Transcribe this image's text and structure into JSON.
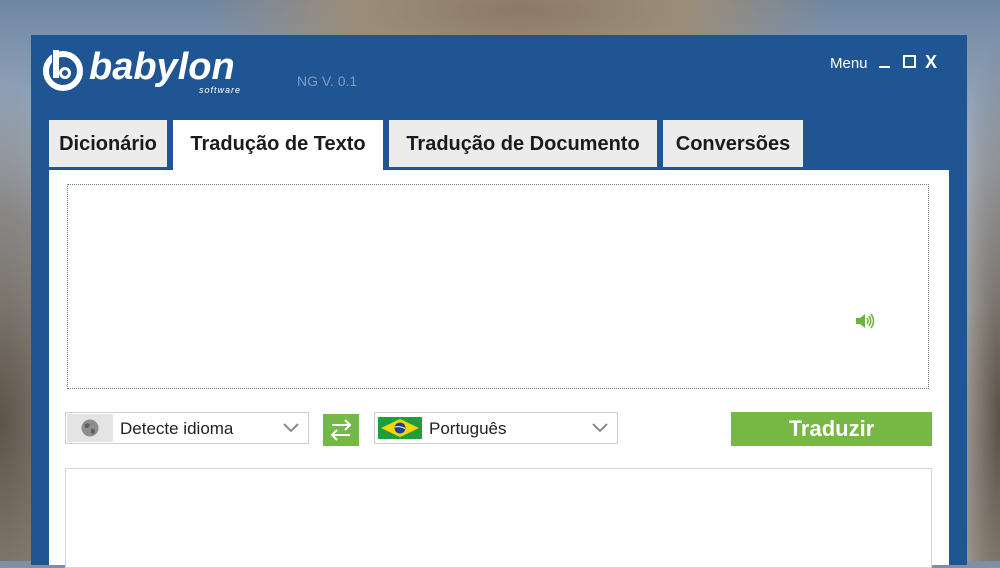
{
  "app": {
    "brand": "babylon",
    "brand_sub": "software",
    "version": "NG V. 0.1",
    "menu_label": "Menu",
    "close_glyph": "X"
  },
  "tabs": [
    {
      "label": "Dicionário",
      "active": false
    },
    {
      "label": "Tradução de Texto",
      "active": true
    },
    {
      "label": "Tradução de Documento",
      "active": false
    },
    {
      "label": "Conversões",
      "active": false
    }
  ],
  "source": {
    "text": "",
    "speaker_icon": "speaker-icon"
  },
  "controls": {
    "from_language": "Detecte idioma",
    "from_icon": "globe-icon",
    "swap_icon": "swap-arrows-icon",
    "to_language": "Português",
    "to_icon": "brazil-flag-icon",
    "translate_label": "Traduzir"
  },
  "target": {
    "text": ""
  },
  "colors": {
    "window_blue": "#1f5592",
    "accent_green": "#77b845"
  }
}
